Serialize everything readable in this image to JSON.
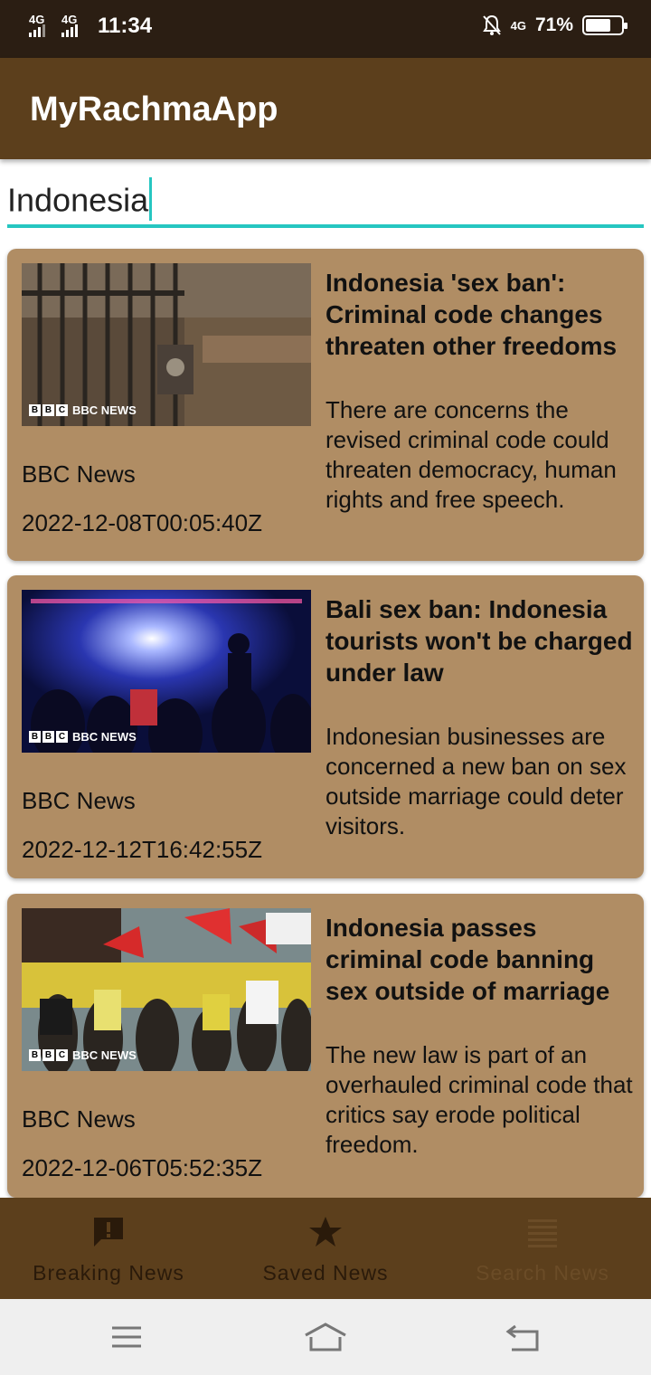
{
  "status_bar": {
    "signal1": "4G",
    "signal2": "4G",
    "time": "11:34",
    "network": "4G",
    "battery": "71%",
    "battery_level": 0.71
  },
  "app_bar": {
    "title": "MyRachmaApp"
  },
  "search": {
    "value": "Indonesia"
  },
  "articles": [
    {
      "title": "Indonesia 'sex ban': Criminal code changes threaten other freedoms",
      "description": "There are concerns the revised criminal code could threaten democracy, human rights and free speech.",
      "source": "BBC News",
      "published_at": "2022-12-08T00:05:40Z",
      "image_label": "BBC NEWS"
    },
    {
      "title": "Bali sex ban: Indonesia tourists won't be charged under law",
      "description": "Indonesian businesses are concerned a new ban on sex outside marriage could deter visitors.",
      "source": "BBC News",
      "published_at": "2022-12-12T16:42:55Z",
      "image_label": "BBC NEWS"
    },
    {
      "title": "Indonesia passes criminal code banning sex outside of marriage",
      "description": "The new law is part of an overhauled criminal code that critics say erode political freedom.",
      "source": "BBC News",
      "published_at": "2022-12-06T05:52:35Z",
      "image_label": "BBC NEWS"
    }
  ],
  "bottom_nav": [
    {
      "label": "Breaking News",
      "icon": "alert-message-icon",
      "active": false
    },
    {
      "label": "Saved News",
      "icon": "star-icon",
      "active": false
    },
    {
      "label": "Search News",
      "icon": "list-icon",
      "active": true
    }
  ],
  "system_nav": {
    "icons": [
      "menu-icon",
      "home-icon",
      "back-icon"
    ]
  },
  "colors": {
    "app_bar": "#5c3f1c",
    "card": "#b08d64",
    "accent": "#26c6c1",
    "status_bar": "#2b1e13"
  }
}
